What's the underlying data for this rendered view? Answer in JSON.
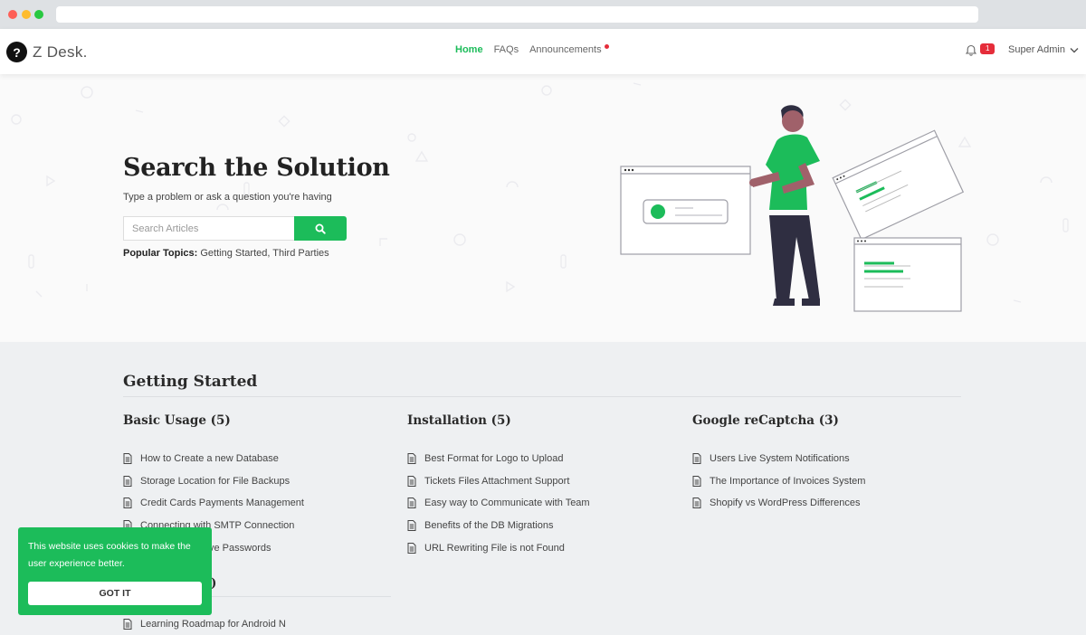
{
  "nav": {
    "logo_mark": "?",
    "logo_text": "Z Desk.",
    "links": [
      {
        "label": "Home",
        "active": true
      },
      {
        "label": "FAQs",
        "active": false
      },
      {
        "label": "Announcements",
        "active": false
      }
    ],
    "notification_count": "1",
    "user_name": "Super Admin",
    "icons": {
      "bell": "bell-icon",
      "chevron": "chevron-down-icon"
    }
  },
  "hero": {
    "title": "Search the Solution",
    "subtitle": "Type a problem or ask a question you're having",
    "search_placeholder": "Search Articles",
    "popular_label": "Popular Topics:",
    "popular_topics": "Getting Started, Third Parties"
  },
  "section": {
    "title": "Getting Started",
    "columns": [
      {
        "title": "Basic Usage (5)",
        "articles": [
          "How to Create a new Database",
          "Storage Location for File Backups",
          "Credit Cards Payments Management",
          "Connecting with SMTP Connection",
          "ve Passwords"
        ]
      },
      {
        "title": "Installation (5)",
        "articles": [
          "Best Format for Logo to Upload",
          "Tickets Files Attachment Support",
          "Easy way to Communicate with Team",
          "Benefits of the DB Migrations",
          "URL Rewriting File is not Found"
        ]
      },
      {
        "title": "Google reCaptcha (3)",
        "articles": [
          "Users Live System Notifications",
          "The Importance of Invoices System",
          "Shopify vs WordPress Differences"
        ]
      }
    ],
    "partial_subtitle": ")",
    "extra_article": "Learning Roadmap for Android N"
  },
  "cookie": {
    "text": "This website uses cookies to make the user experience better.",
    "button": "GOT IT"
  },
  "colors": {
    "accent": "#1cbc5a",
    "badge": "#e52d3a"
  }
}
